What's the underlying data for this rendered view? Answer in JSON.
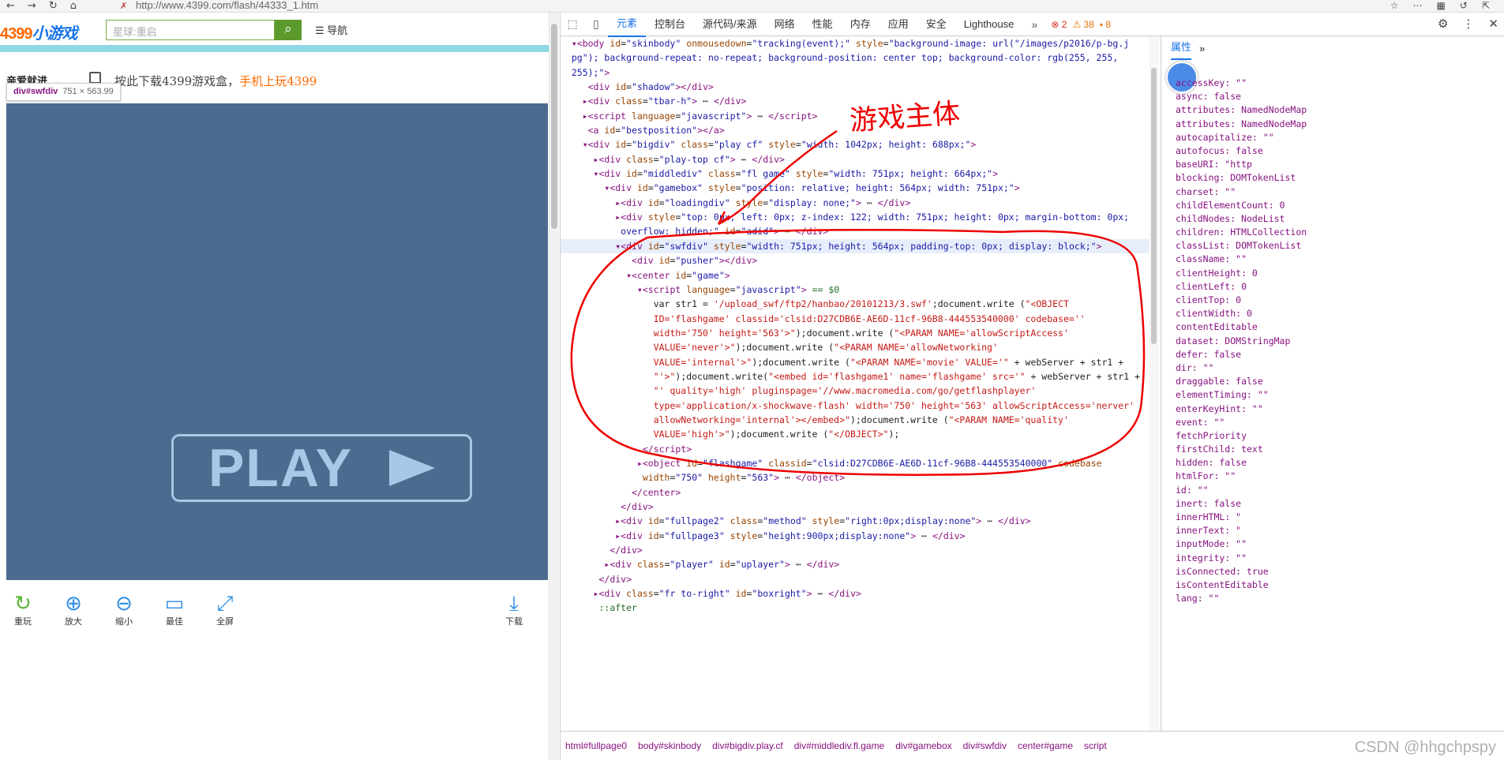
{
  "browser": {
    "url": "http://www.4399.com/flash/44333_1.htm",
    "security_indicator": "✗"
  },
  "page": {
    "logo_num": "4399",
    "logo_text": "小游戏",
    "search_placeholder": "星球:重启",
    "nav_label": "导航",
    "left_word": "亲爱就进",
    "promo_text": "按此下载4399游戏盒，",
    "promo_highlight": "手机上玩4399",
    "tooltip_id": "div#swfdiv",
    "tooltip_size": "751 × 563.99",
    "play_label": "PLAY",
    "tools": [
      {
        "icon": "↻",
        "label": "重玩"
      },
      {
        "icon": "⊕",
        "label": "放大"
      },
      {
        "icon": "⊖",
        "label": "缩小"
      },
      {
        "icon": "▭",
        "label": "最佳"
      },
      {
        "icon": "⤢",
        "label": "全屏"
      },
      {
        "icon": "⤓",
        "label": "下载"
      }
    ]
  },
  "devtools": {
    "tabs": [
      "元素",
      "控制台",
      "源代码/来源",
      "网络",
      "性能",
      "内存",
      "应用",
      "安全",
      "Lighthouse"
    ],
    "counts": {
      "errors": "2",
      "warnings": "38",
      "issues": "8"
    },
    "annotation": "游戏主体",
    "side_tab": "属性",
    "side_props": [
      "accessKey: \"\"",
      "async: false",
      "attributes: NamedNodeMap",
      "attributes: NamedNodeMap",
      "autocapitalize: \"\"",
      "autofocus: false",
      "baseURI: \"http",
      "blocking: DOMTokenList",
      "charset: \"\"",
      "childElementCount: 0",
      "childNodes: NodeList",
      "children: HTMLCollection",
      "classList: DOMTokenList",
      "className: \"\"",
      "clientHeight: 0",
      "clientLeft: 0",
      "clientTop: 0",
      "clientWidth: 0",
      "contentEditable",
      "dataset: DOMStringMap",
      "defer: false",
      "dir: \"\"",
      "draggable: false",
      "elementTiming: \"\"",
      "enterKeyHint: \"\"",
      "event: \"\"",
      "fetchPriority",
      "firstChild: text",
      "hidden: false",
      "htmlFor: \"\"",
      "id: \"\"",
      "inert: false",
      "innerHTML: \"",
      "innerText: \"",
      "inputMode: \"\"",
      "integrity: \"\"",
      "isConnected: true",
      "isContentEditable",
      "lang: \"\""
    ],
    "breadcrumbs": [
      "html#fullpage0",
      "body#skinbody",
      "div#bigdiv.play.cf",
      "div#middlediv.fl.game",
      "div#gamebox",
      "div#swfdiv",
      "center#game",
      "script"
    ],
    "watermark": "CSDN @hhgchpspy"
  }
}
